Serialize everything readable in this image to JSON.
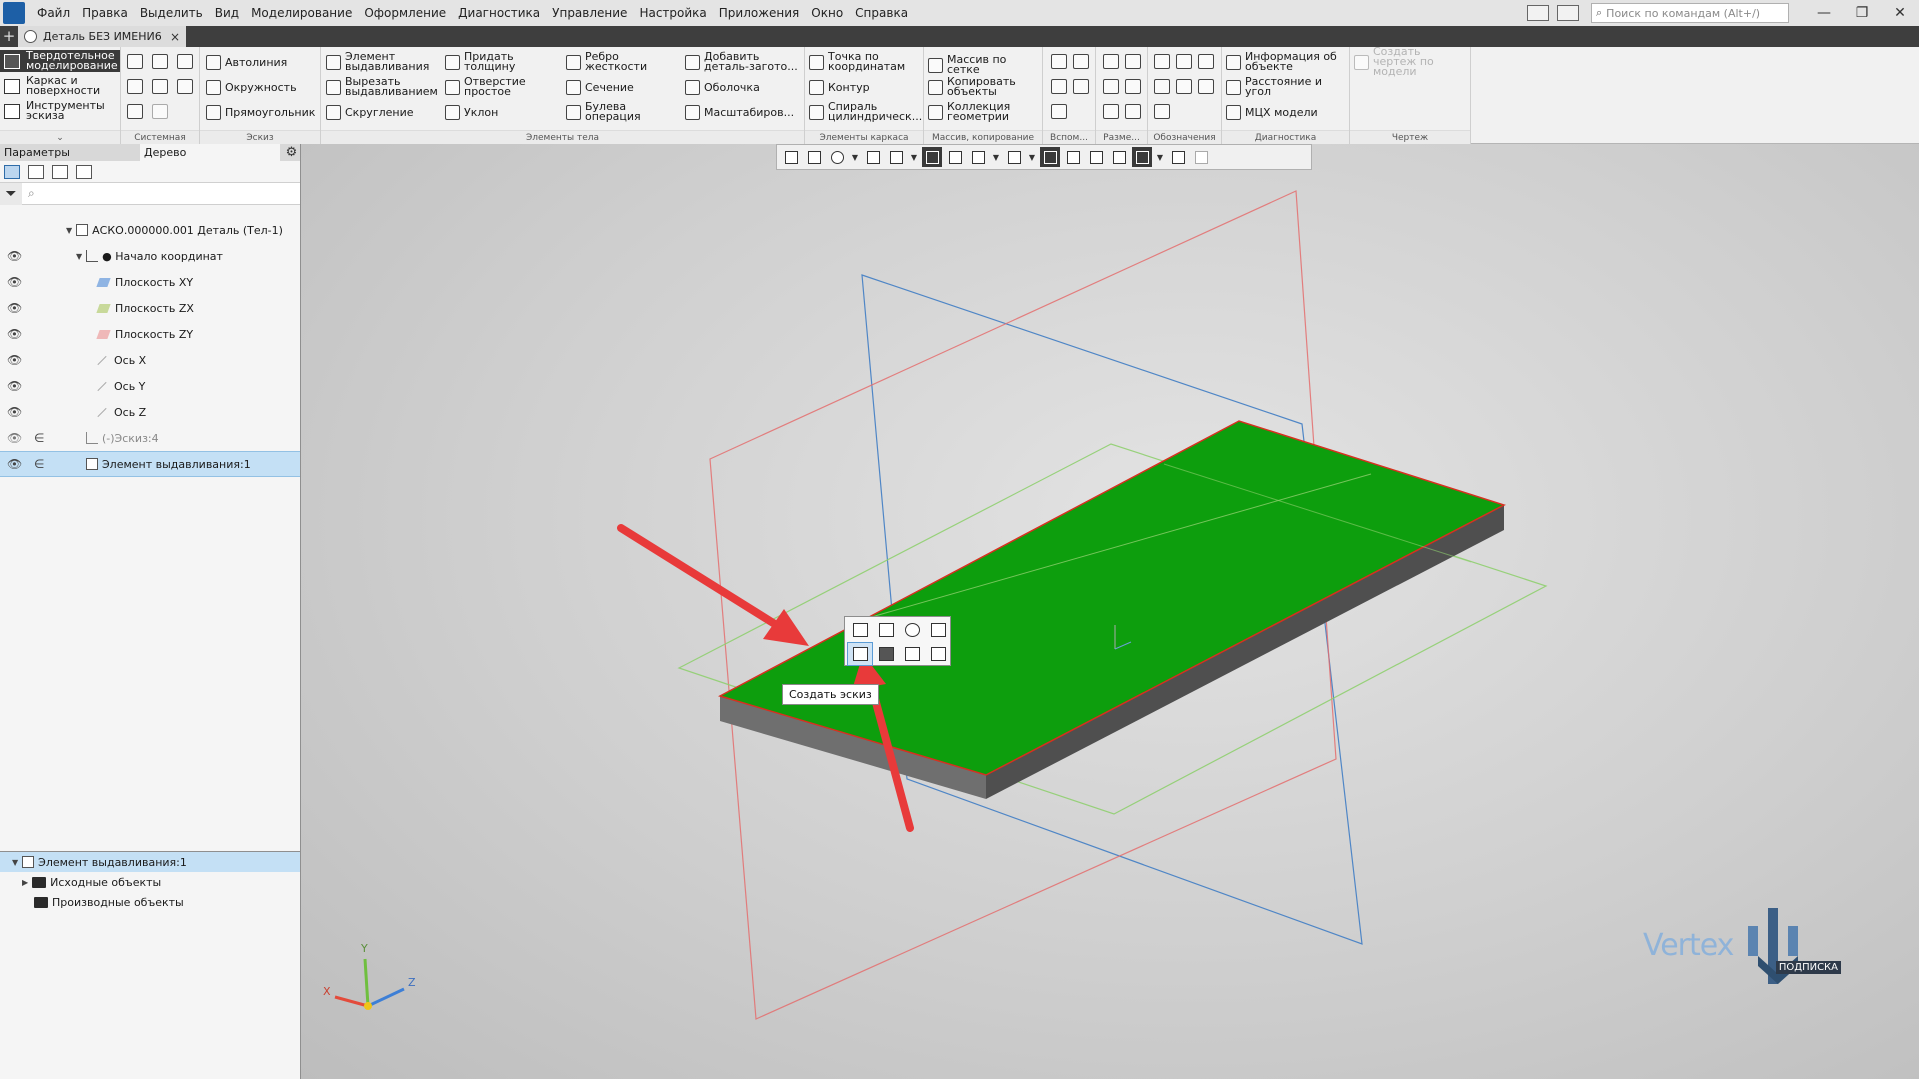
{
  "menu": {
    "items": [
      "Файл",
      "Правка",
      "Выделить",
      "Вид",
      "Моделирование",
      "Оформление",
      "Диагностика",
      "Управление",
      "Настройка",
      "Приложения",
      "Окно",
      "Справка"
    ],
    "search_placeholder": "Поиск по командам (Alt+/)"
  },
  "tabbar": {
    "plus": "+",
    "doc_tab": "Деталь БЕЗ ИМЕНИ6",
    "close": "×"
  },
  "ribbon": {
    "modes": {
      "solid": "Твердотельное моделирование",
      "frame": "Каркас и поверхности",
      "sketch_tools": "Инструменты эскиза"
    },
    "sketch": {
      "autoline": "Автолиния",
      "circle": "Окружность",
      "rectangle": "Прямоугольник"
    },
    "body": {
      "extrude": "Элемент выдавливания",
      "cut_extrude": "Вырезать выдавливанием",
      "fillet": "Скругление",
      "thicken": "Придать толщину",
      "hole": "Отверстие простое",
      "draft": "Уклон",
      "rib": "Ребро жесткости",
      "section": "Сечение",
      "boolean": "Булева операция",
      "add_part": "Добавить деталь-загото...",
      "shell": "Оболочка",
      "scale": "Масштабиров..."
    },
    "frame": {
      "point": "Точка по координатам",
      "contour": "Контур",
      "spiral": "Спираль цилиндрическ..."
    },
    "arrays": {
      "grid": "Массив по сетке",
      "copy": "Копировать объекты",
      "collection": "Коллекция геометрии"
    },
    "diagnostics": {
      "info": "Информация об объекте",
      "distance": "Расстояние и угол",
      "mass": "МЦХ модели"
    },
    "drawing": {
      "create": "Создать чертеж по модели"
    },
    "group_labels": {
      "system": "Системная",
      "sketch": "Эскиз",
      "body": "Элементы тела",
      "frame": "Элементы каркаса",
      "array": "Массив, копирование",
      "aux": "Вспом...",
      "dims": "Разме...",
      "marks": "Обозначения",
      "diag": "Диагностика",
      "drawing": "Чертеж"
    }
  },
  "panel": {
    "tabs": [
      "Параметры",
      "Дерево"
    ],
    "tree": [
      {
        "label": "АСКО.000000.001 Деталь (Тел-1)",
        "eye": "",
        "link": ""
      },
      {
        "label": "● Начало координат",
        "eye": "👁",
        "link": ""
      },
      {
        "label": "Плоскость XY",
        "eye": "👁",
        "link": ""
      },
      {
        "label": "Плоскость ZX",
        "eye": "👁",
        "link": ""
      },
      {
        "label": "Плоскость ZY",
        "eye": "👁",
        "link": ""
      },
      {
        "label": "Ось X",
        "eye": "👁",
        "link": ""
      },
      {
        "label": "Ось Y",
        "eye": "👁",
        "link": ""
      },
      {
        "label": "Ось Z",
        "eye": "👁",
        "link": ""
      },
      {
        "label": "(-)Эскиз:4",
        "eye": "👁",
        "link": "∈"
      },
      {
        "label": "Элемент выдавливания:1",
        "eye": "👁",
        "link": "∈"
      }
    ],
    "bottom_tree": [
      {
        "label": "Элемент выдавливания:1"
      },
      {
        "label": "Исходные объекты"
      },
      {
        "label": "Производные объекты"
      }
    ]
  },
  "viewport": {
    "tooltip": "Создать эскиз",
    "triad": {
      "x": "X",
      "y": "Y",
      "z": "Z"
    },
    "watermark": {
      "brand": "Vertex",
      "sub": "ПОДПИСКА"
    }
  },
  "colors": {
    "part_top": "#0d9e0d",
    "part_side": "#6f6f6f",
    "edge": "#d7301f",
    "plane_xy": "#4f86c6",
    "plane_zx": "#e46d6d",
    "plane_zy": "#8fcf6f",
    "arrow": "#e83a3a",
    "selection": "#c4e0f5"
  },
  "icons": [
    "app-logo-icon",
    "search-icon",
    "gear-icon",
    "eye-icon",
    "filter-icon",
    "folder-icon"
  ]
}
